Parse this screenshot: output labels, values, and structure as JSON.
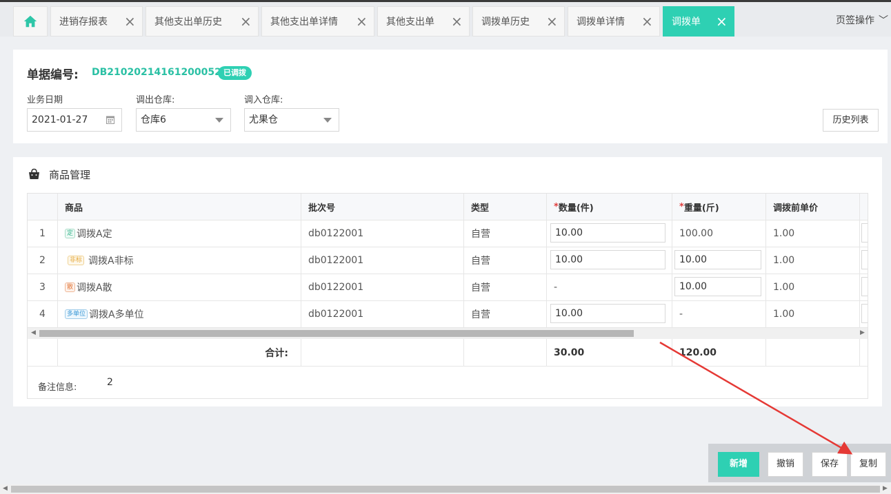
{
  "tabs": [
    {
      "label": "",
      "icon": "home-icon"
    },
    {
      "label": "进销存报表"
    },
    {
      "label": "其他支出单历史"
    },
    {
      "label": "其他支出单详情"
    },
    {
      "label": "其他支出单"
    },
    {
      "label": "调拨单历史"
    },
    {
      "label": "调拨单详情"
    },
    {
      "label": "调拨单",
      "active": true
    }
  ],
  "tab_ops_label": "页签操作",
  "header": {
    "doc_label": "单据编号:",
    "doc_no": "DB210202141612000523",
    "status_badge": "已调拨",
    "date_label": "业务日期",
    "date_value": "2021-01-27",
    "out_label": "调出仓库:",
    "out_value": "仓库6",
    "in_label": "调入仓库:",
    "in_value": "尤果仓",
    "history_button": "历史列表"
  },
  "goods": {
    "title": "商品管理",
    "columns": [
      "",
      "商品",
      "批次号",
      "类型",
      "数量(件)",
      "重量(斤)",
      "调拨前单价"
    ],
    "rows": [
      {
        "idx": "1",
        "tag": "定",
        "name": "调拨A定",
        "batch": "db0122001",
        "type": "自营",
        "qty": "10.00",
        "weight": "100.00",
        "price": "1.00"
      },
      {
        "idx": "2",
        "tag": "非标",
        "name": "调拨A非标",
        "batch": "db0122001",
        "type": "自营",
        "qty": "10.00",
        "weight": "10.00",
        "price": "1.00"
      },
      {
        "idx": "3",
        "tag": "散",
        "name": "调拨A散",
        "batch": "db0122001",
        "type": "自营",
        "qty": "-",
        "weight": "10.00",
        "price": "1.00"
      },
      {
        "idx": "4",
        "tag": "多单位",
        "name": "调拨A多单位",
        "batch": "db0122001",
        "type": "自营",
        "qty": "10.00",
        "weight": "-",
        "price": "1.00"
      }
    ],
    "total_label": "合计:",
    "total_qty": "30.00",
    "total_weight": "120.00",
    "note_label": "备注信息:",
    "note_value": "2"
  },
  "actions": {
    "new": "新增",
    "revoke": "撤销",
    "save": "保存",
    "copy": "复制"
  },
  "colors": {
    "accent": "#2ed0b3",
    "annotation": "#e53935"
  }
}
